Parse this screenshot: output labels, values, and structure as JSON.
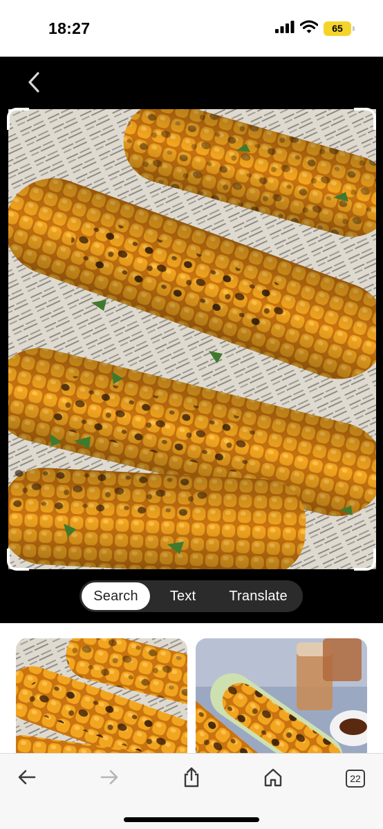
{
  "status_bar": {
    "time": "18:27",
    "battery_level": "65",
    "icons": [
      "cellular-signal-icon",
      "wifi-icon",
      "battery-icon"
    ]
  },
  "lens": {
    "back_icon": "chevron-left-icon",
    "image_subject": "grilled-corn-on-newspaper",
    "mode_tabs": [
      {
        "label": "Search",
        "active": true
      },
      {
        "label": "Text",
        "active": false
      },
      {
        "label": "Translate",
        "active": false
      }
    ]
  },
  "results": {
    "thumbnails": [
      "grilled-corn-result-1",
      "grilled-corn-result-2"
    ]
  },
  "toolbar": {
    "back_icon": "arrow-left-icon",
    "forward_icon": "arrow-right-icon",
    "share_icon": "share-icon",
    "home_icon": "home-icon",
    "tabs_count": "22"
  },
  "colors": {
    "battery": "#f4d42b",
    "lens_background": "#000000",
    "switch_background": "#2b2b2b",
    "corn": "#e89a1c"
  }
}
